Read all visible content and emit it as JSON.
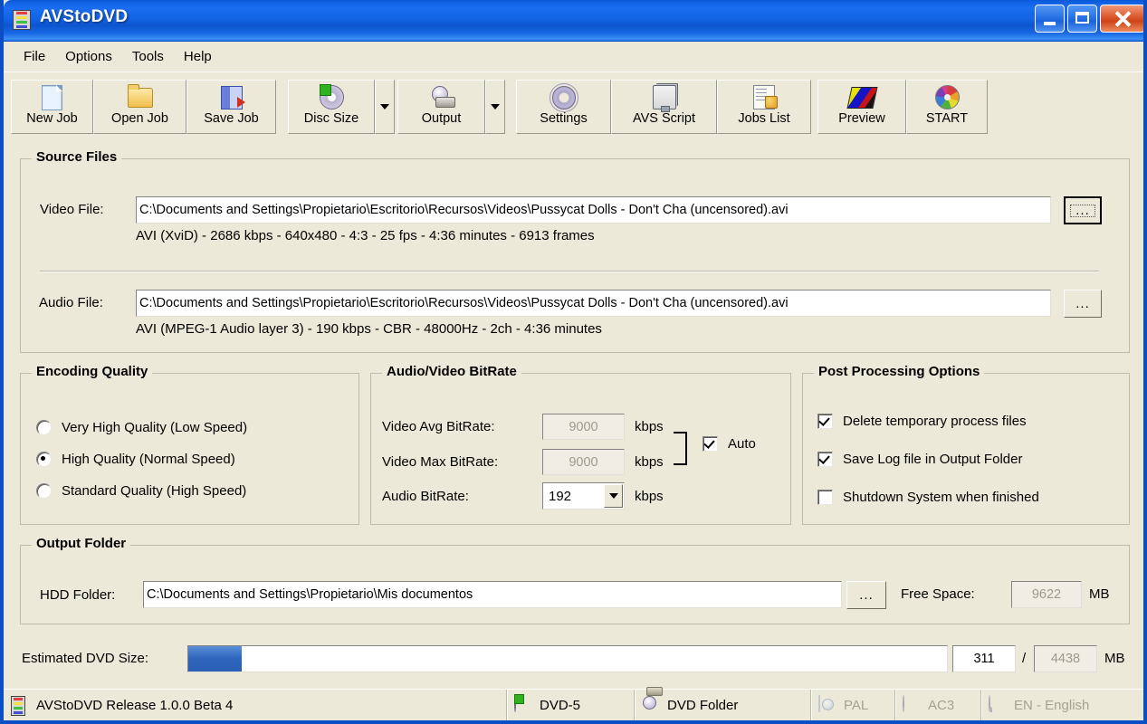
{
  "window": {
    "title": "AVStoDVD",
    "icon": "film-strip-icon",
    "minimize_label": "Minimize",
    "maximize_label": "Maximize",
    "close_label": "Close"
  },
  "menu": {
    "items": [
      {
        "label": "File"
      },
      {
        "label": "Options"
      },
      {
        "label": "Tools"
      },
      {
        "label": "Help"
      }
    ]
  },
  "toolbar": {
    "buttons": [
      {
        "label": "New Job",
        "icon": "new-document-icon"
      },
      {
        "label": "Open Job",
        "icon": "open-folder-icon"
      },
      {
        "label": "Save Job",
        "icon": "save-disk-icon"
      },
      {
        "label": "Disc Size",
        "icon": "disc-size-icon",
        "has_dropdown": true
      },
      {
        "label": "Output",
        "icon": "output-disc-icon",
        "has_dropdown": true
      },
      {
        "label": "Settings",
        "icon": "gear-icon"
      },
      {
        "label": "AVS Script",
        "icon": "avs-script-icon"
      },
      {
        "label": "Jobs List",
        "icon": "jobs-list-icon"
      },
      {
        "label": "Preview",
        "icon": "preview-film-icon"
      },
      {
        "label": "START",
        "icon": "color-wheel-icon"
      }
    ]
  },
  "source_files": {
    "group_title": "Source Files",
    "video": {
      "label": "Video File:",
      "path": "C:\\Documents and Settings\\Propietario\\Escritorio\\Recursos\\Videos\\Pussycat Dolls - Don't Cha (uncensored).avi",
      "info": "AVI (XviD) - 2686 kbps - 640x480 - 4:3 - 25 fps - 4:36 minutes - 6913 frames",
      "browse_label": "..."
    },
    "audio": {
      "label": "Audio File:",
      "path": "C:\\Documents and Settings\\Propietario\\Escritorio\\Recursos\\Videos\\Pussycat Dolls - Don't Cha (uncensored).avi",
      "info": "AVI (MPEG-1 Audio layer 3) - 190 kbps - CBR - 48000Hz - 2ch - 4:36 minutes",
      "browse_label": "..."
    }
  },
  "encoding_quality": {
    "group_title": "Encoding Quality",
    "options": [
      {
        "label": "Very High Quality (Low Speed)",
        "selected": false
      },
      {
        "label": "High Quality (Normal Speed)",
        "selected": true
      },
      {
        "label": "Standard Quality (High Speed)",
        "selected": false
      }
    ]
  },
  "bitrate": {
    "group_title": "Audio/Video BitRate",
    "video_avg": {
      "label": "Video Avg BitRate:",
      "value": "9000",
      "unit": "kbps",
      "disabled": true
    },
    "video_max": {
      "label": "Video Max BitRate:",
      "value": "9000",
      "unit": "kbps",
      "disabled": true
    },
    "audio": {
      "label": "Audio BitRate:",
      "value": "192",
      "unit": "kbps",
      "disabled": false
    },
    "auto": {
      "label": "Auto",
      "checked": true
    }
  },
  "post_processing": {
    "group_title": "Post Processing Options",
    "options": [
      {
        "label": "Delete temporary process files",
        "checked": true
      },
      {
        "label": "Save Log file in Output Folder",
        "checked": true
      },
      {
        "label": "Shutdown System when finished",
        "checked": false
      }
    ]
  },
  "output_folder": {
    "group_title": "Output Folder",
    "label": "HDD Folder:",
    "path": "C:\\Documents and Settings\\Propietario\\Mis documentos",
    "browse_label": "...",
    "free_space_label": "Free Space:",
    "free_space_value": "9622",
    "free_space_unit": "MB"
  },
  "estimated": {
    "label": "Estimated DVD Size:",
    "progress_percent": 7,
    "current": "311",
    "separator": "/",
    "total": "4438",
    "unit": "MB"
  },
  "statusbar": {
    "items": [
      {
        "label": "AVStoDVD Release 1.0.0 Beta 4",
        "icon": "film-strip-icon",
        "dim": false
      },
      {
        "label": "DVD-5",
        "icon": "disc-icon",
        "dim": false
      },
      {
        "label": "DVD Folder",
        "icon": "dvd-folder-icon",
        "dim": false
      },
      {
        "label": "PAL",
        "icon": "pal-tv-icon",
        "dim": true
      },
      {
        "label": "AC3",
        "icon": "audio-disc-icon",
        "dim": true
      },
      {
        "label": "EN - English",
        "icon": "language-icon",
        "dim": true
      }
    ]
  },
  "colors": {
    "window_bg": "#ECE9D8",
    "title_blue": "#1262E4",
    "progress_blue": "#2F67BE",
    "close_red": "#CD4417"
  }
}
